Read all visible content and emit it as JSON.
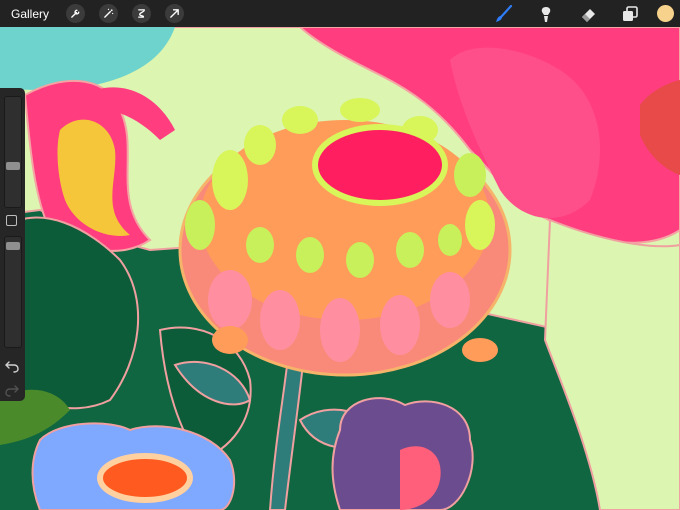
{
  "topbar": {
    "gallery_label": "Gallery",
    "left_tools": [
      {
        "icon": "wrench-icon"
      },
      {
        "icon": "magic-wand-icon"
      },
      {
        "icon": "selection-icon"
      },
      {
        "icon": "transform-arrow-icon"
      }
    ],
    "right_tools": [
      {
        "icon": "brush-icon",
        "color": "#2e7cf6"
      },
      {
        "icon": "smudge-icon",
        "color": "#e8e8e8"
      },
      {
        "icon": "eraser-icon",
        "color": "#e8e8e8"
      },
      {
        "icon": "layers-icon",
        "color": "#e8e8e8"
      }
    ],
    "current_color": "#f6d28c"
  },
  "sidebar": {
    "brush_size_level": 0.35,
    "opacity_level": 0.95
  },
  "canvas_colors": {
    "background_green": "#0f6640",
    "pale_green": "#dcf5b0",
    "pink": "#ff3d7f",
    "teal": "#6dd3cc",
    "peach": "#ffb09a"
  }
}
